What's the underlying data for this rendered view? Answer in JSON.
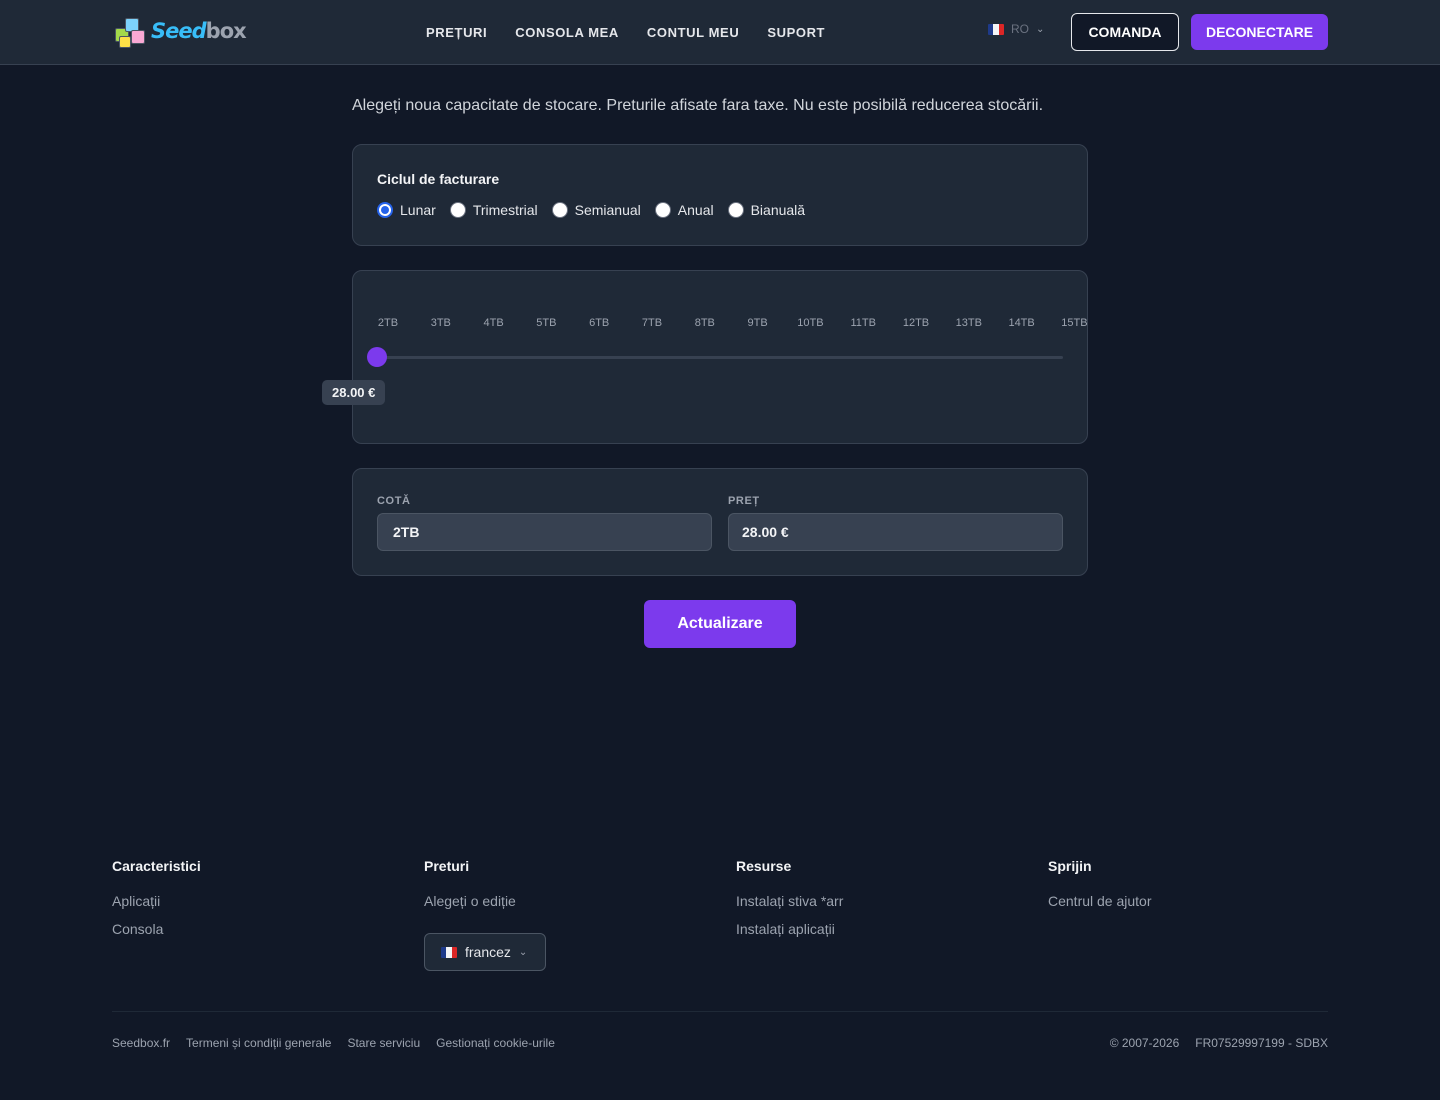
{
  "header": {
    "logo_seed": "Seed",
    "logo_box": "box",
    "nav": [
      "PREȚURI",
      "CONSOLA MEA",
      "CONTUL MEU",
      "SUPORT"
    ],
    "lang_code": "RO",
    "order_label": "COMANDA",
    "logout_label": "DECONECTARE"
  },
  "main": {
    "intro": "Alegeți noua capacitate de stocare. Preturile afisate fara taxe. Nu este posibilă reducerea stocării.",
    "billing": {
      "title": "Ciclul de facturare",
      "options": [
        "Lunar",
        "Trimestrial",
        "Semianual",
        "Anual",
        "Bianuală"
      ],
      "selected": "Lunar"
    },
    "slider": {
      "ticks": [
        "2TB",
        "3TB",
        "4TB",
        "5TB",
        "6TB",
        "7TB",
        "8TB",
        "9TB",
        "10TB",
        "11TB",
        "12TB",
        "13TB",
        "14TB",
        "15TB"
      ],
      "value": "2TB",
      "price": "28.00 €"
    },
    "quota_label": "COTĂ",
    "quota_value": "2TB",
    "price_label": "PREȚ",
    "price_value": "28.00 €",
    "update_label": "Actualizare"
  },
  "footer": {
    "columns": [
      {
        "title": "Caracteristici",
        "links": [
          "Aplicații",
          "Consola"
        ]
      },
      {
        "title": "Preturi",
        "links": [
          "Alegeți o ediție"
        ]
      },
      {
        "title": "Resurse",
        "links": [
          "Instalați stiva *arr",
          "Instalați aplicații"
        ]
      },
      {
        "title": "Sprijin",
        "links": [
          "Centrul de ajutor"
        ]
      }
    ],
    "language": "francez",
    "bottom_links": [
      "Seedbox.fr",
      "Termeni și condiții generale",
      "Stare serviciu",
      "Gestionați cookie-urile"
    ],
    "copyright": "© 2007-2026",
    "company_id": "FR07529997199 - SDBX"
  },
  "colors": {
    "accent": "#7c3aed",
    "background": "#111827",
    "card": "#1f2937"
  }
}
